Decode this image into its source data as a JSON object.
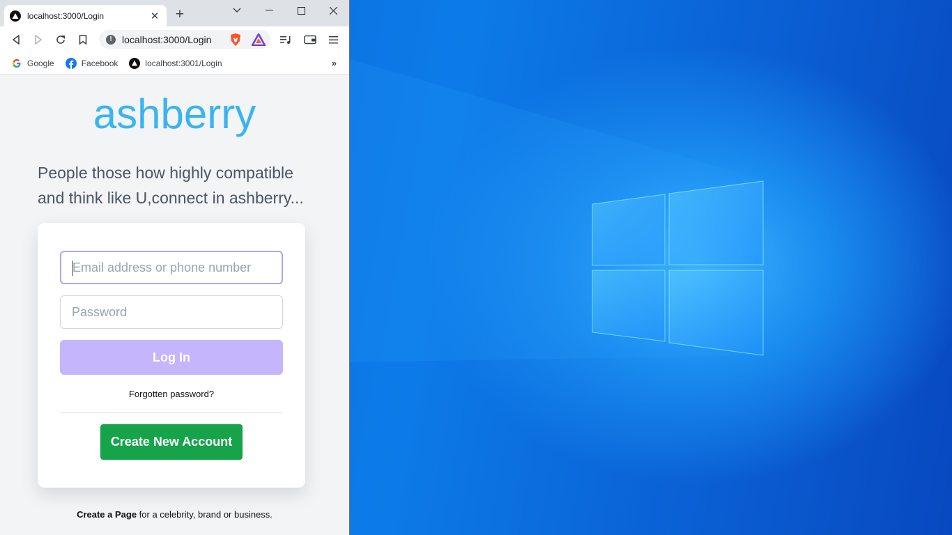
{
  "browser": {
    "tab": {
      "title": "localhost:3000/Login",
      "close": "✕"
    },
    "new_tab": "+",
    "address": "localhost:3000/Login",
    "bookmarks": [
      {
        "label": "Google",
        "icon": "google-icon"
      },
      {
        "label": "Facebook",
        "icon": "facebook-icon"
      },
      {
        "label": "localhost:3001/Login",
        "icon": "site-icon"
      }
    ],
    "bookmarks_more": "»"
  },
  "page": {
    "brand": "ashberry",
    "tagline": "People those how highly compatible and think like U,connect in ashberry...",
    "email_placeholder": "Email address or phone number",
    "password_placeholder": "Password",
    "login_label": "Log In",
    "forgot_label": "Forgotten password?",
    "create_label": "Create New Account",
    "footer_link": "Create a Page",
    "footer_text": " for a celebrity, brand or business."
  },
  "colors": {
    "brand": "#3ab4ef",
    "login_button": "#c4b5fd",
    "create_button": "#16a34a"
  }
}
